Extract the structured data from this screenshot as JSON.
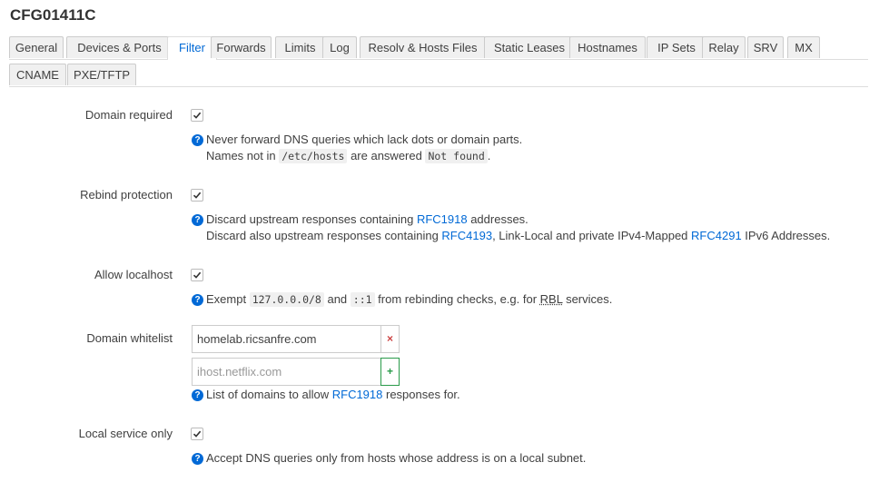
{
  "page": {
    "title": "CFG01411C"
  },
  "tabs": [
    "General",
    "Devices & Ports",
    "Filter",
    "Forwards",
    "Limits",
    "Log",
    "Resolv & Hosts Files",
    "Static Leases",
    "Hostnames",
    "IP Sets",
    "Relay",
    "SRV",
    "MX",
    "CNAME",
    "PXE/TFTP"
  ],
  "active_tab": "Filter",
  "fields": {
    "domain_required": {
      "label": "Domain required",
      "checked": true,
      "help1": "Never forward DNS queries which lack dots or domain parts.",
      "help2a": "Names not in ",
      "help2_code1": "/etc/hosts",
      "help2b": " are answered ",
      "help2_code2": "Not found",
      "help2c": "."
    },
    "rebind_protection": {
      "label": "Rebind protection",
      "checked": true,
      "help1a": "Discard upstream responses containing ",
      "help1_link": "RFC1918",
      "help1b": " addresses.",
      "help2a": "Discard also upstream responses containing ",
      "help2_link1": "RFC4193",
      "help2b": ", Link-Local and private IPv4-Mapped ",
      "help2_link2": "RFC4291",
      "help2c": " IPv6 Addresses."
    },
    "allow_localhost": {
      "label": "Allow localhost",
      "checked": true,
      "help_a": "Exempt ",
      "help_code1": "127.0.0.0/8",
      "help_b": " and ",
      "help_code2": "::1",
      "help_c": " from rebinding checks, e.g. for ",
      "help_abbr": "RBL",
      "help_d": " services."
    },
    "domain_whitelist": {
      "label": "Domain whitelist",
      "value": "homelab.ricsanfre.com",
      "placeholder": "ihost.netflix.com",
      "remove_symbol": "×",
      "add_symbol": "+",
      "help_a": "List of domains to allow ",
      "help_link": "RFC1918",
      "help_b": " responses for."
    },
    "local_service_only": {
      "label": "Local service only",
      "checked": true,
      "help": "Accept DNS queries only from hosts whose address is on a local subnet."
    }
  },
  "icons": {
    "help": "?"
  },
  "colors": {
    "link": "#0069d6",
    "add": "#2a9b4a",
    "remove": "#cc4444"
  }
}
